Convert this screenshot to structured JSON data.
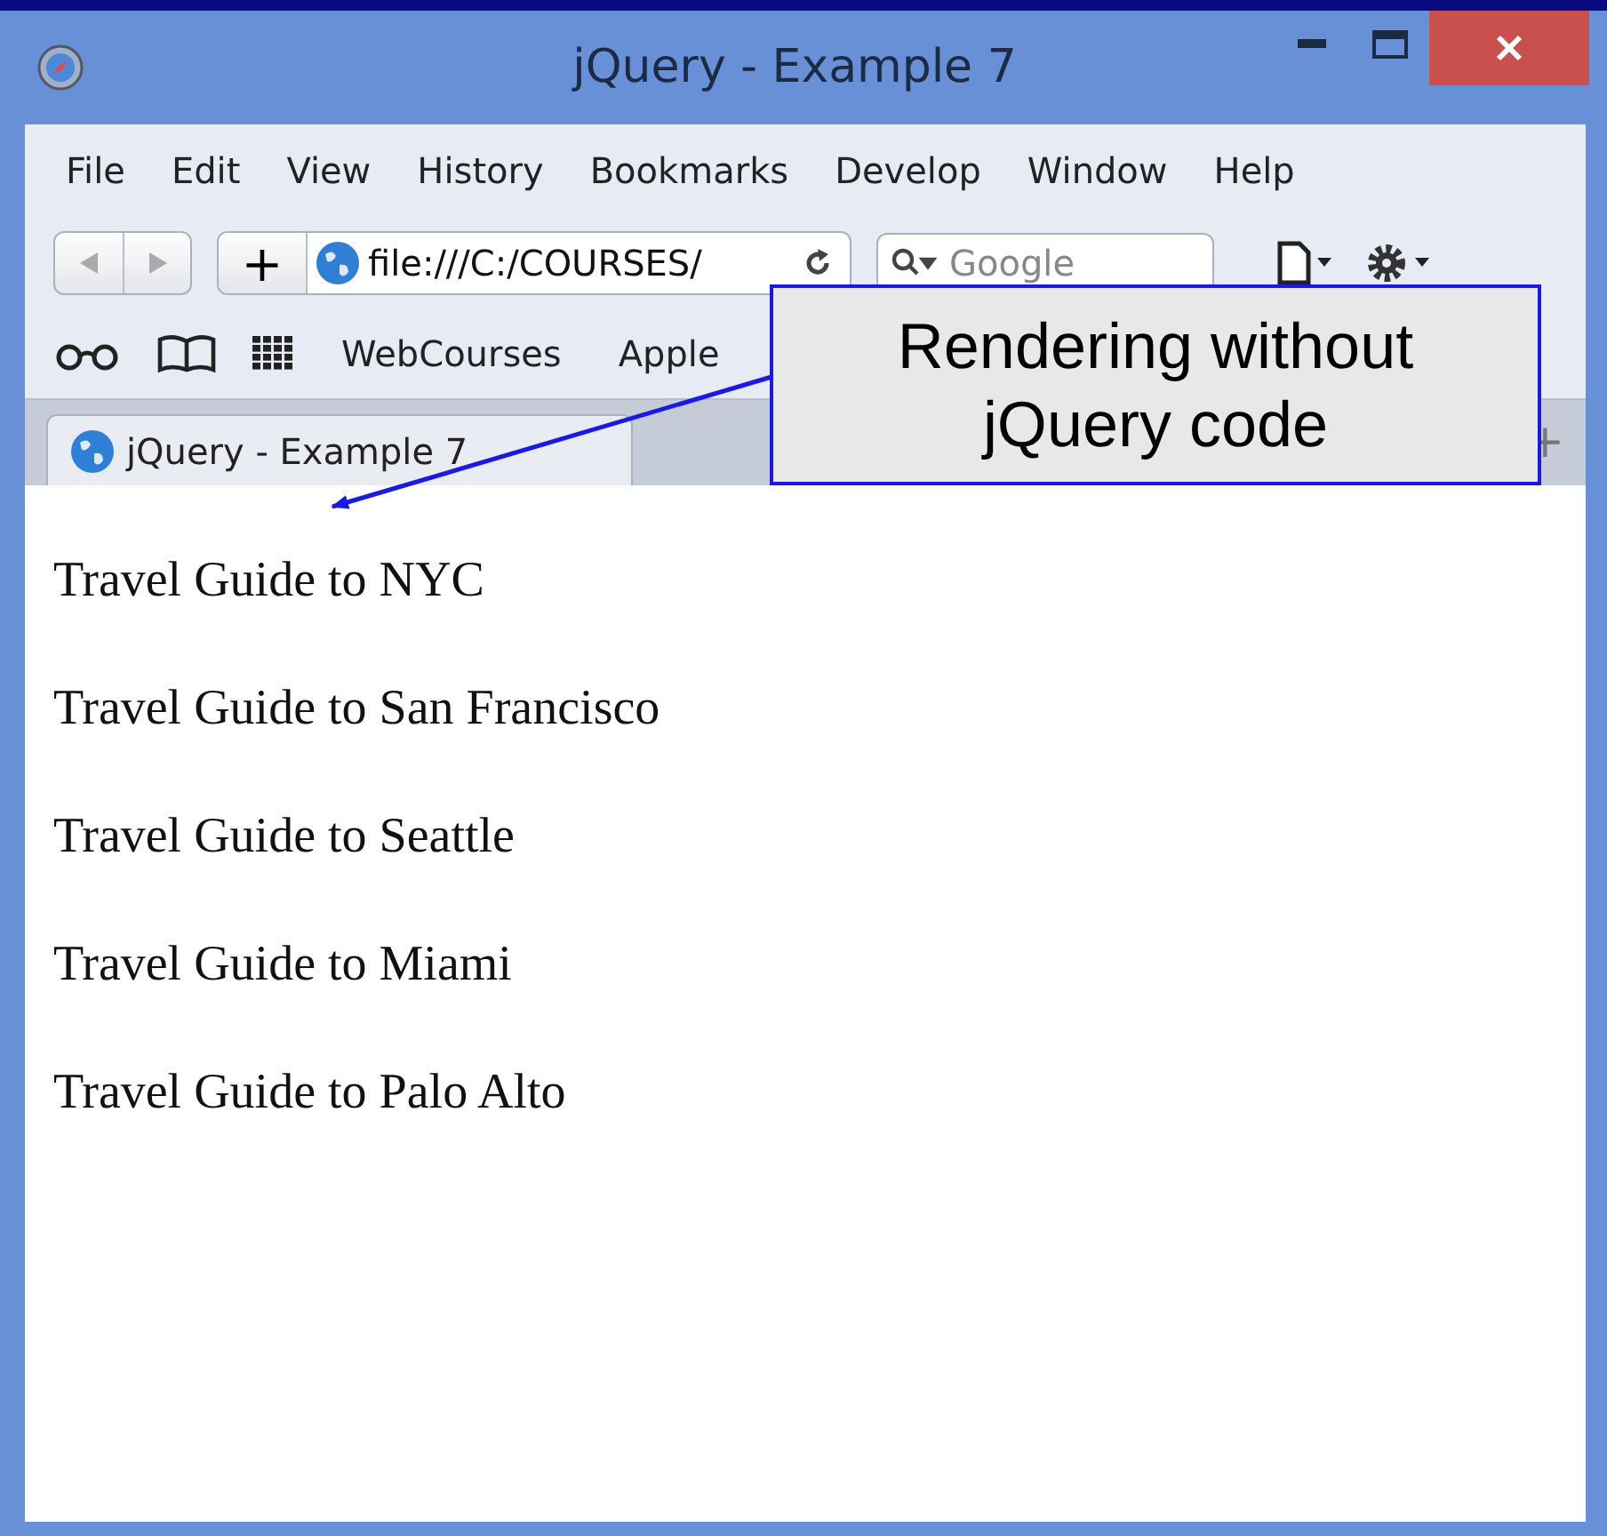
{
  "window": {
    "title": "jQuery - Example 7"
  },
  "menu": [
    "File",
    "Edit",
    "View",
    "History",
    "Bookmarks",
    "Develop",
    "Window",
    "Help"
  ],
  "toolbar": {
    "new_tab": "+",
    "address": "file:///C:/COURSES/",
    "search_placeholder": "Google"
  },
  "bookmarks": [
    "WebCourses",
    "Apple"
  ],
  "tabs": [
    {
      "label": "jQuery - Example 7",
      "selected": true
    }
  ],
  "new_tab_button": "+",
  "content": [
    "Travel Guide to NYC",
    "Travel Guide to San Francisco",
    "Travel Guide to Seattle",
    "Travel Guide to Miami",
    "Travel Guide to Palo Alto"
  ],
  "callout": {
    "text": "Rendering without jQuery code"
  }
}
